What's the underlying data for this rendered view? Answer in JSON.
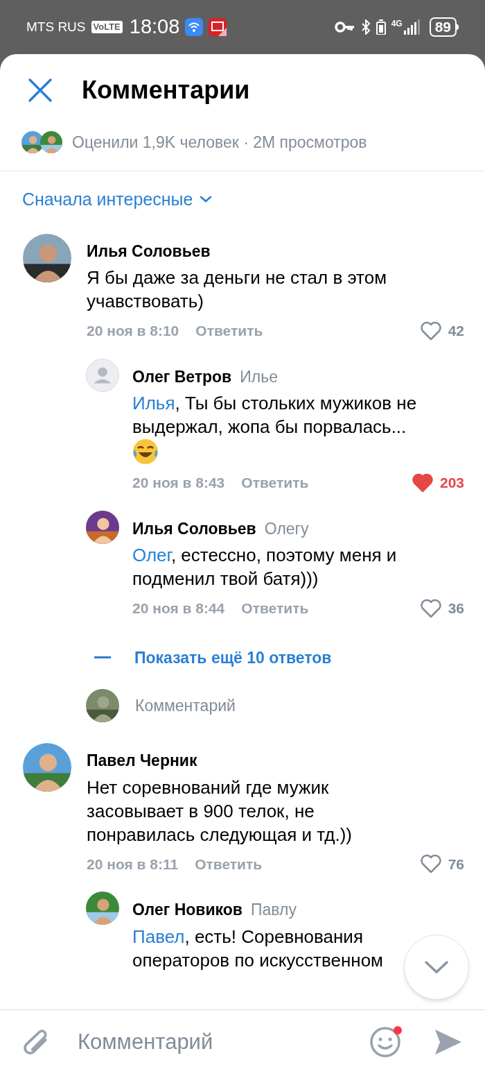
{
  "status_bar": {
    "carrier": "MTS RUS",
    "volte": "VoLTE",
    "time": "18:08",
    "network": "4G",
    "battery": "89"
  },
  "header": {
    "title": "Комментарии",
    "stats": "Оценили 1,9K человек · 2M просмотров"
  },
  "sort": {
    "label": "Сначала интересные"
  },
  "comments": [
    {
      "author": "Илья Соловьев",
      "text": "Я бы даже за деньги не стал в этом учавствовать)",
      "time": "20 ноя в 8:10",
      "reply": "Ответить",
      "likes": "42",
      "liked": false,
      "replies": [
        {
          "author": "Олег Ветров",
          "to": "Илье",
          "kind": "placeholder",
          "mention": "Илья",
          "text": ", Ты бы стольких мужиков не выдержал, жопа бы порвалась...",
          "emoji": true,
          "time": "20 ноя в 8:43",
          "reply": "Ответить",
          "likes": "203",
          "liked": true
        },
        {
          "author": "Илья Соловьев",
          "to": "Олегу",
          "mention": "Олег",
          "text": ", естессно, поэтому меня и подменил твой батя)))",
          "emoji": false,
          "time": "20 ноя в 8:44",
          "reply": "Ответить",
          "likes": "36",
          "liked": false
        }
      ],
      "more": "Показать ещё 10 ответов",
      "input_placeholder": "Комментарий"
    },
    {
      "author": "Павел Черник",
      "text": "Нет соревнований где мужик засовывает в 900 телок, не понравилась следующая и тд.))",
      "time": "20 ноя в 8:11",
      "reply": "Ответить",
      "likes": "76",
      "liked": false,
      "replies": [
        {
          "author": "Олег Новиков",
          "to": "Павлу",
          "mention": "Павел",
          "text": ", есть! Соревнования операторов по искусственном",
          "emoji": false
        }
      ]
    }
  ],
  "composer": {
    "placeholder": "Комментарий",
    "emoji_notification": true
  }
}
